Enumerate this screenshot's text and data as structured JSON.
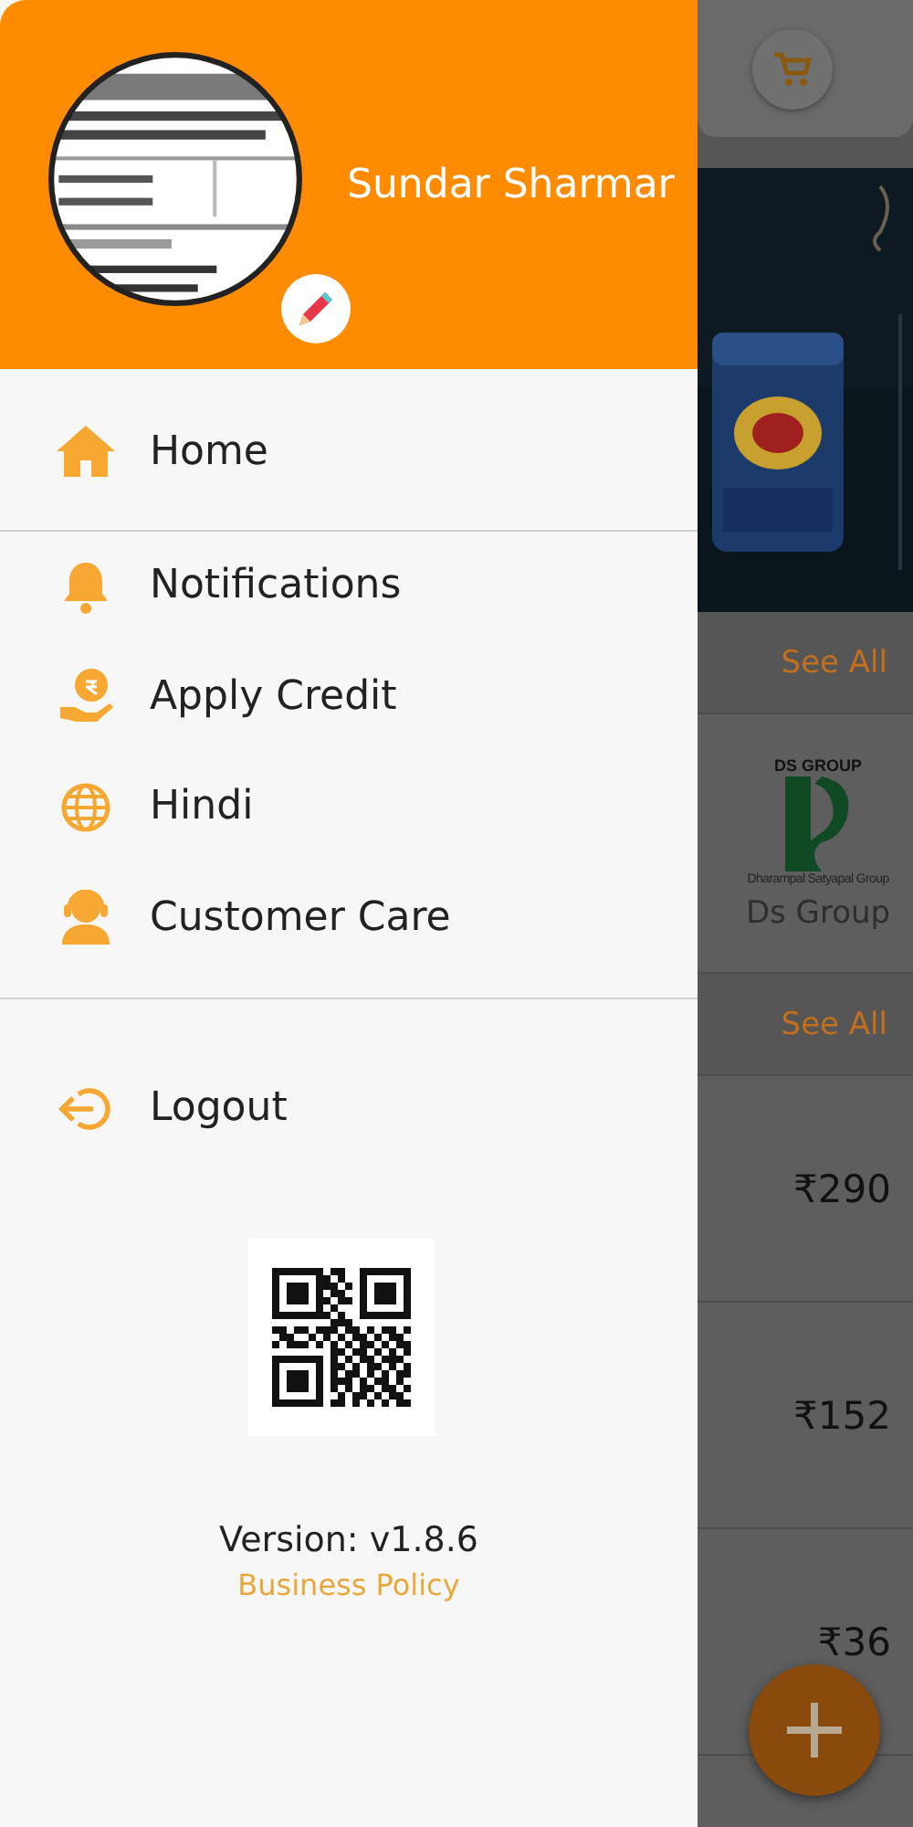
{
  "drawer": {
    "header": {
      "name": "Sundar Sharmar"
    },
    "sections": [
      [
        {
          "label": "Home"
        }
      ],
      [
        {
          "label": "Notifications"
        },
        {
          "label": "Apply Credit"
        },
        {
          "label": "Hindi"
        },
        {
          "label": "Customer Care"
        }
      ],
      [
        {
          "label": "Logout"
        }
      ]
    ],
    "version": "Version: v1.8.6",
    "policy_link": "Business Policy"
  },
  "background_page": {
    "see_all": [
      "See All",
      "See All"
    ],
    "brand": {
      "logo_title": "DS GROUP",
      "logo_subtitle": "Dharampal Satyapal Group",
      "name": "Ds Group"
    },
    "prices": [
      "₹290",
      "₹152",
      "₹36"
    ]
  }
}
